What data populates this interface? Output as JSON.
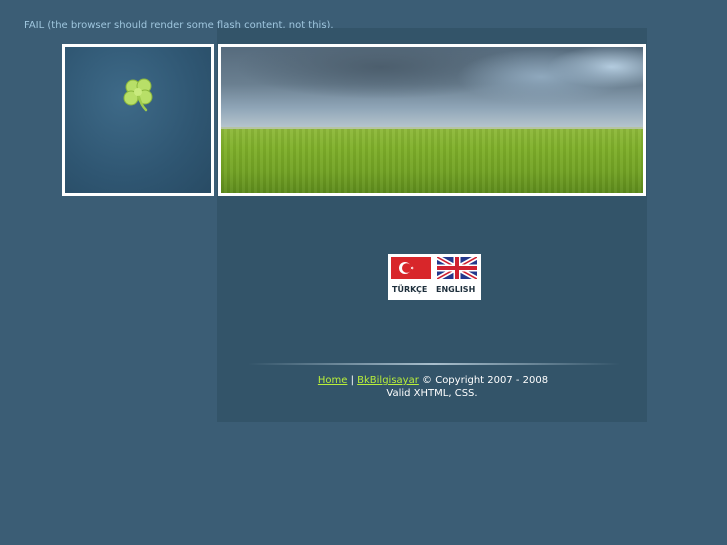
{
  "fail_message": "FAIL (the browser should render some flash content, not this).",
  "languages": [
    {
      "label": "TÜRKÇE",
      "flag": "turkey-flag"
    },
    {
      "label": "ENGLISH",
      "flag": "uk-flag"
    }
  ],
  "footer": {
    "home_link": "Home",
    "separator": "|",
    "site_link": "BkBilgisayar",
    "copyright": "© Copyright 2007 - 2008",
    "valid": "Valid XHTML, CSS."
  },
  "colors": {
    "background": "#3b5d75",
    "content_panel": "#335469",
    "link": "#b9ef3a"
  }
}
